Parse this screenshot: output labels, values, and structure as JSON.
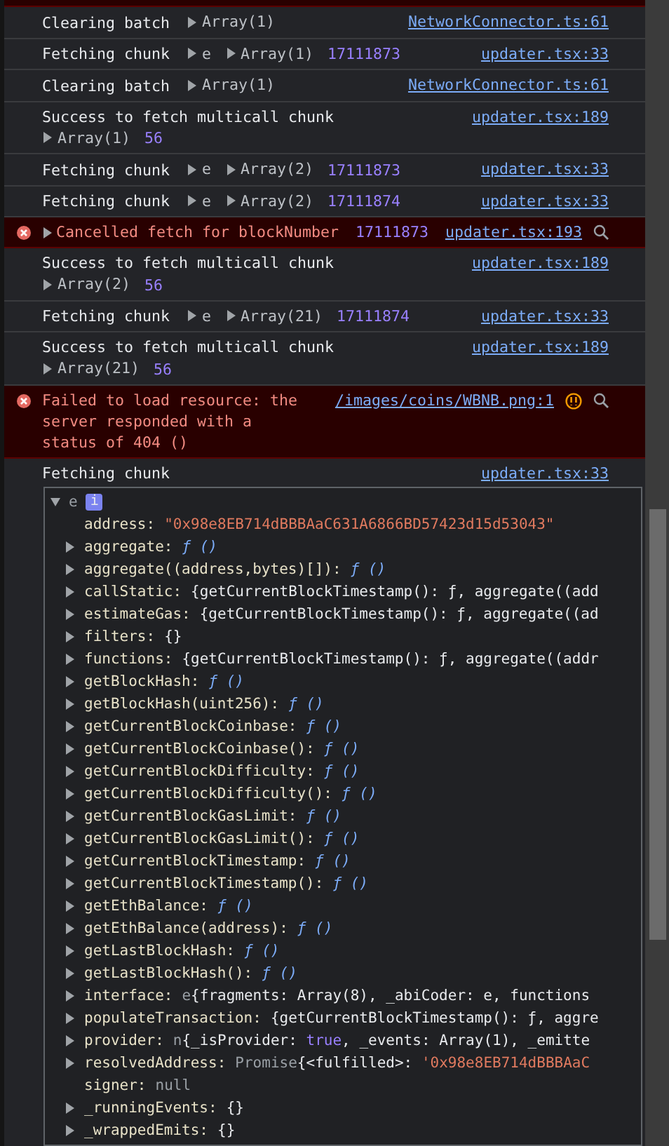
{
  "messages": [
    {
      "kind": "error",
      "cut": true
    },
    {
      "kind": "log",
      "text": "Clearing batch",
      "expandable": false,
      "parts": [
        {
          "kind": "object",
          "text": "Array(1)"
        }
      ],
      "source": "NetworkConnector.ts:61",
      "issue_badge": false,
      "cut": false
    },
    {
      "kind": "log",
      "text": "Fetching chunk",
      "expandable": false,
      "parts": [
        {
          "kind": "object",
          "text": "e"
        },
        {
          "kind": "object",
          "text": "Array(1)"
        },
        {
          "kind": "number",
          "text": "17111873"
        }
      ],
      "source": "updater.tsx:33",
      "issue_badge": false,
      "cut": false
    },
    {
      "kind": "log",
      "text": "Clearing batch",
      "expandable": false,
      "parts": [
        {
          "kind": "object",
          "text": "Array(1)"
        }
      ],
      "source": "NetworkConnector.ts:61",
      "issue_badge": false,
      "cut": false
    },
    {
      "kind": "log",
      "text": "Success to fetch multicall chunk",
      "expandable": false,
      "parts": [
        {
          "kind": "object",
          "text": "Array(1)"
        },
        {
          "kind": "number",
          "text": "56"
        }
      ],
      "source": "updater.tsx:189",
      "issue_badge": false,
      "cut": false
    },
    {
      "kind": "log",
      "text": "Fetching chunk",
      "expandable": false,
      "parts": [
        {
          "kind": "object",
          "text": "e"
        },
        {
          "kind": "object",
          "text": "Array(2)"
        },
        {
          "kind": "number",
          "text": "17111873"
        }
      ],
      "source": "updater.tsx:33",
      "issue_badge": false,
      "cut": false
    },
    {
      "kind": "log",
      "text": "Fetching chunk",
      "expandable": false,
      "parts": [
        {
          "kind": "object",
          "text": "e"
        },
        {
          "kind": "object",
          "text": "Array(2)"
        },
        {
          "kind": "number",
          "text": "17111874"
        }
      ],
      "source": "updater.tsx:33",
      "issue_badge": false,
      "cut": false
    },
    {
      "kind": "error",
      "text": "Cancelled fetch for blockNumber",
      "expandable": true,
      "parts": [
        {
          "kind": "number",
          "text": "17111873"
        }
      ],
      "source": "updater.tsx:193",
      "issue_badge": false,
      "cut": false
    },
    {
      "kind": "log",
      "text": "Success to fetch multicall chunk",
      "expandable": false,
      "parts": [
        {
          "kind": "object",
          "text": "Array(2)"
        },
        {
          "kind": "number",
          "text": "56"
        }
      ],
      "source": "updater.tsx:189",
      "issue_badge": false,
      "cut": false
    },
    {
      "kind": "log",
      "text": "Fetching chunk",
      "expandable": false,
      "parts": [
        {
          "kind": "object",
          "text": "e"
        },
        {
          "kind": "object",
          "text": "Array(21)"
        },
        {
          "kind": "number",
          "text": "17111874"
        }
      ],
      "source": "updater.tsx:33",
      "issue_badge": false,
      "cut": false
    },
    {
      "kind": "log",
      "text": "Success to fetch multicall chunk",
      "expandable": false,
      "parts": [
        {
          "kind": "object",
          "text": "Array(21)"
        },
        {
          "kind": "number",
          "text": "56"
        }
      ],
      "source": "updater.tsx:189",
      "issue_badge": false,
      "cut": false
    },
    {
      "kind": "error",
      "text": "Failed to load resource: the server responded with a status of 404 ()",
      "expandable": false,
      "source": "/images/coins/WBNB.png:1",
      "issue_badge": true,
      "cut": false
    },
    {
      "kind": "log",
      "text": "Fetching chunk",
      "expandable": false,
      "source": "updater.tsx:33",
      "issue_badge": false,
      "cut": false
    }
  ],
  "object_tree": {
    "name": "e",
    "expanded": true,
    "info_badge": "i",
    "properties": [
      {
        "key": "address:",
        "expandable": false,
        "value": [
          {
            "kind": "string",
            "text": "\"0x98e8EB714dBBBAaC631A6866BD57423d15d53043\""
          }
        ]
      },
      {
        "key": "aggregate:",
        "expandable": true,
        "value": [
          {
            "kind": "function",
            "text": "ƒ ()"
          }
        ]
      },
      {
        "key": "aggregate((address,bytes)[]):",
        "expandable": true,
        "value": [
          {
            "kind": "function",
            "text": "ƒ ()"
          }
        ]
      },
      {
        "key": "callStatic:",
        "expandable": true,
        "value": [
          {
            "kind": "plain",
            "text": "{getCurrentBlockTimestamp(): ƒ, aggregate((add"
          }
        ]
      },
      {
        "key": "estimateGas:",
        "expandable": true,
        "value": [
          {
            "kind": "plain",
            "text": "{getCurrentBlockTimestamp(): ƒ, aggregate((ad"
          }
        ]
      },
      {
        "key": "filters:",
        "expandable": true,
        "value": [
          {
            "kind": "plain",
            "text": "{}"
          }
        ]
      },
      {
        "key": "functions:",
        "expandable": true,
        "value": [
          {
            "kind": "plain",
            "text": "{getCurrentBlockTimestamp(): ƒ, aggregate((addr"
          }
        ]
      },
      {
        "key": "getBlockHash:",
        "expandable": true,
        "value": [
          {
            "kind": "function",
            "text": "ƒ ()"
          }
        ]
      },
      {
        "key": "getBlockHash(uint256):",
        "expandable": true,
        "value": [
          {
            "kind": "function",
            "text": "ƒ ()"
          }
        ]
      },
      {
        "key": "getCurrentBlockCoinbase:",
        "expandable": true,
        "value": [
          {
            "kind": "function",
            "text": "ƒ ()"
          }
        ]
      },
      {
        "key": "getCurrentBlockCoinbase():",
        "expandable": true,
        "value": [
          {
            "kind": "function",
            "text": "ƒ ()"
          }
        ]
      },
      {
        "key": "getCurrentBlockDifficulty:",
        "expandable": true,
        "value": [
          {
            "kind": "function",
            "text": "ƒ ()"
          }
        ]
      },
      {
        "key": "getCurrentBlockDifficulty():",
        "expandable": true,
        "value": [
          {
            "kind": "function",
            "text": "ƒ ()"
          }
        ]
      },
      {
        "key": "getCurrentBlockGasLimit:",
        "expandable": true,
        "value": [
          {
            "kind": "function",
            "text": "ƒ ()"
          }
        ]
      },
      {
        "key": "getCurrentBlockGasLimit():",
        "expandable": true,
        "value": [
          {
            "kind": "function",
            "text": "ƒ ()"
          }
        ]
      },
      {
        "key": "getCurrentBlockTimestamp:",
        "expandable": true,
        "value": [
          {
            "kind": "function",
            "text": "ƒ ()"
          }
        ]
      },
      {
        "key": "getCurrentBlockTimestamp():",
        "expandable": true,
        "value": [
          {
            "kind": "function",
            "text": "ƒ ()"
          }
        ]
      },
      {
        "key": "getEthBalance:",
        "expandable": true,
        "value": [
          {
            "kind": "function",
            "text": "ƒ ()"
          }
        ]
      },
      {
        "key": "getEthBalance(address):",
        "expandable": true,
        "value": [
          {
            "kind": "function",
            "text": "ƒ ()"
          }
        ]
      },
      {
        "key": "getLastBlockHash:",
        "expandable": true,
        "value": [
          {
            "kind": "function",
            "text": "ƒ ()"
          }
        ]
      },
      {
        "key": "getLastBlockHash():",
        "expandable": true,
        "value": [
          {
            "kind": "function",
            "text": "ƒ ()"
          }
        ]
      },
      {
        "key": "interface:",
        "expandable": true,
        "value": [
          {
            "kind": "grey",
            "text": "e"
          },
          {
            "kind": "plain",
            "text": "{fragments: Array(8), _abiCoder: e, functions"
          }
        ]
      },
      {
        "key": "populateTransaction:",
        "expandable": true,
        "value": [
          {
            "kind": "plain",
            "text": "{getCurrentBlockTimestamp(): ƒ, aggre"
          }
        ]
      },
      {
        "key": "provider:",
        "expandable": true,
        "value": [
          {
            "kind": "grey",
            "text": "n"
          },
          {
            "kind": "plain",
            "text": "{_isProvider: "
          },
          {
            "kind": "keyword",
            "text": "true"
          },
          {
            "kind": "plain",
            "text": ", _events: Array(1), _emitte"
          }
        ]
      },
      {
        "key": "resolvedAddress:",
        "expandable": true,
        "value": [
          {
            "kind": "grey",
            "text": "Promise"
          },
          {
            "kind": "plain",
            "text": "{<fulfilled>: "
          },
          {
            "kind": "string",
            "text": "'0x98e8EB714dBBBAaC"
          }
        ]
      },
      {
        "key": "signer:",
        "expandable": false,
        "value": [
          {
            "kind": "grey",
            "text": "null"
          }
        ]
      },
      {
        "key": "_runningEvents:",
        "expandable": true,
        "value": [
          {
            "kind": "plain",
            "text": "{}"
          }
        ]
      },
      {
        "key": "_wrappedEmits:",
        "expandable": true,
        "value": [
          {
            "kind": "plain",
            "text": "{}"
          }
        ]
      }
    ]
  }
}
